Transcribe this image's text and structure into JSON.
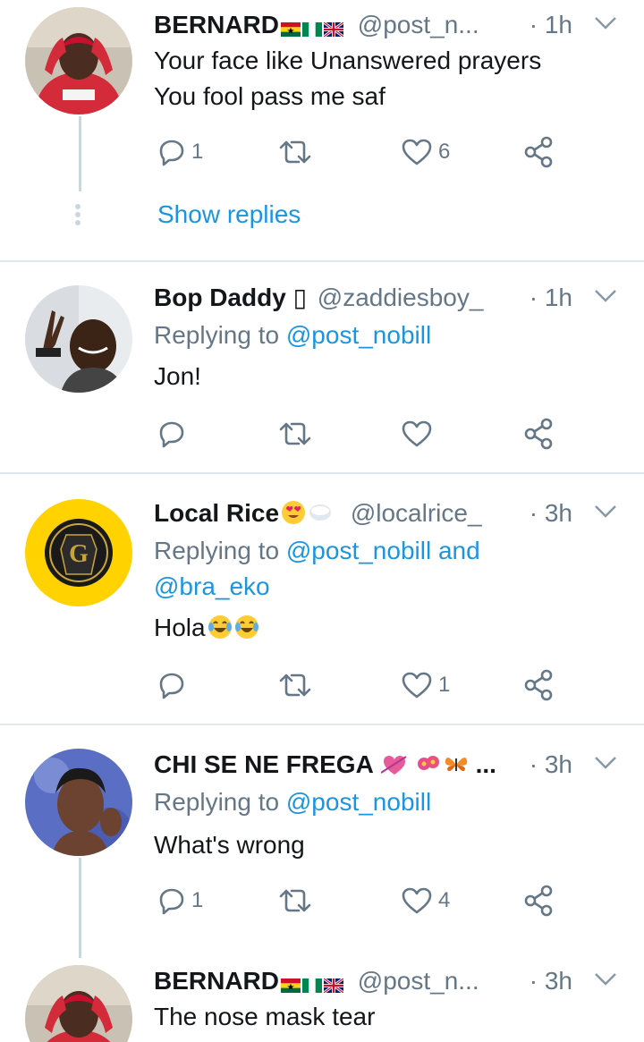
{
  "tweets": [
    {
      "name": "BERNARD",
      "flags": [
        "ghana",
        "nigeria",
        "uk"
      ],
      "handle": "@post_n...",
      "time": "· 1h",
      "lines": [
        "Your face like Unanswered prayers",
        "You fool pass me saf"
      ],
      "replies": "1",
      "likes": "6",
      "show_replies": "Show replies"
    },
    {
      "name": "Bop Daddy",
      "name_suffix": "▯",
      "handle": "@zaddiesboy_",
      "time": "· 1h",
      "replying_prefix": "Replying to",
      "replying_to": "@post_nobill",
      "lines": [
        "Jon!"
      ],
      "replies": "",
      "likes": ""
    },
    {
      "name": "Local Rice",
      "handle": "@localrice_",
      "time": "· 3h",
      "replying_prefix": "Replying to",
      "replying_to": "@post_nobill and",
      "replying_to_2": "@bra_eko",
      "lines": [
        "Hola"
      ],
      "replies": "",
      "likes": "1"
    },
    {
      "name": "CHI SE NE FREGA",
      "name_suffix": "...",
      "handle": "",
      "time": "· 3h",
      "replying_prefix": "Replying to",
      "replying_to": "@post_nobill",
      "lines": [
        "What's wrong"
      ],
      "replies": "1",
      "likes": "4"
    },
    {
      "name": "BERNARD",
      "flags": [
        "ghana",
        "nigeria",
        "uk"
      ],
      "handle": "@post_n...",
      "time": "· 3h",
      "lines": [
        "The nose mask tear"
      ]
    }
  ],
  "colors": {
    "text": "#14171a",
    "secondary": "#657786",
    "link": "#1b95e0",
    "divider": "#e1e8ed"
  },
  "icons": [
    "reply-icon",
    "retweet-icon",
    "like-icon",
    "share-icon",
    "chevron-down-icon"
  ]
}
